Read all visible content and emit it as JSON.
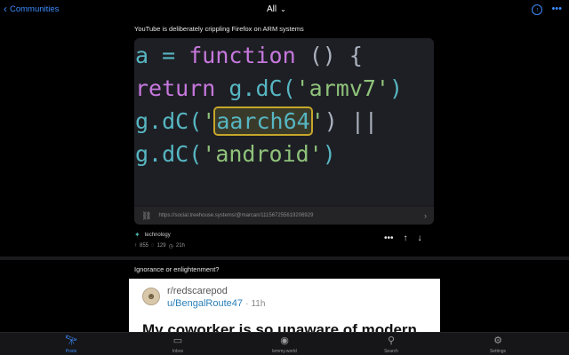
{
  "topbar": {
    "back_label": "Communities",
    "feed_title": "All",
    "icons": [
      "chevron-left-icon",
      "chevron-down-icon",
      "arrow-up-circle-icon",
      "ellipsis-icon"
    ]
  },
  "post1": {
    "title": "YouTube is deliberately crippling Firefox on ARM systems",
    "code_lines": {
      "l1a": "a = ",
      "l1b": "function",
      "l1c": " () {",
      "l2a": "return",
      "l2b": " g.dC(",
      "l2c": "'armv7'",
      "l2d": ")",
      "l3a": "g.dC(",
      "l3b": "'",
      "l3c": "aarch64",
      "l3d": "'",
      "l3e": ") ||",
      "l4a": "g.dC(",
      "l4b": "'android'",
      "l4c": ")"
    },
    "link_url": "https://social.treehouse.systems/@marcan/111567255619206929",
    "community": "technology",
    "upvotes": "855",
    "comments": "129",
    "age": "21h"
  },
  "post2": {
    "title": "Ignorance or enlightenment?",
    "subreddit": "r/redscarepod",
    "username": "u/BengalRoute47",
    "separator": "·",
    "time": "11h",
    "headline": "My coworker is so unaware of modern"
  },
  "tabs": [
    {
      "label": "Posts",
      "icon": "telescope-icon",
      "active": true
    },
    {
      "label": "Inbox",
      "icon": "inbox-icon",
      "active": false
    },
    {
      "label": "lemmy.world",
      "icon": "person-circle-icon",
      "active": false
    },
    {
      "label": "Search",
      "icon": "search-icon",
      "active": false
    },
    {
      "label": "Settings",
      "icon": "gear-icon",
      "active": false
    }
  ],
  "colors": {
    "accent": "#3d8bfd",
    "background": "#000000",
    "highlight": "#c6a62a"
  }
}
